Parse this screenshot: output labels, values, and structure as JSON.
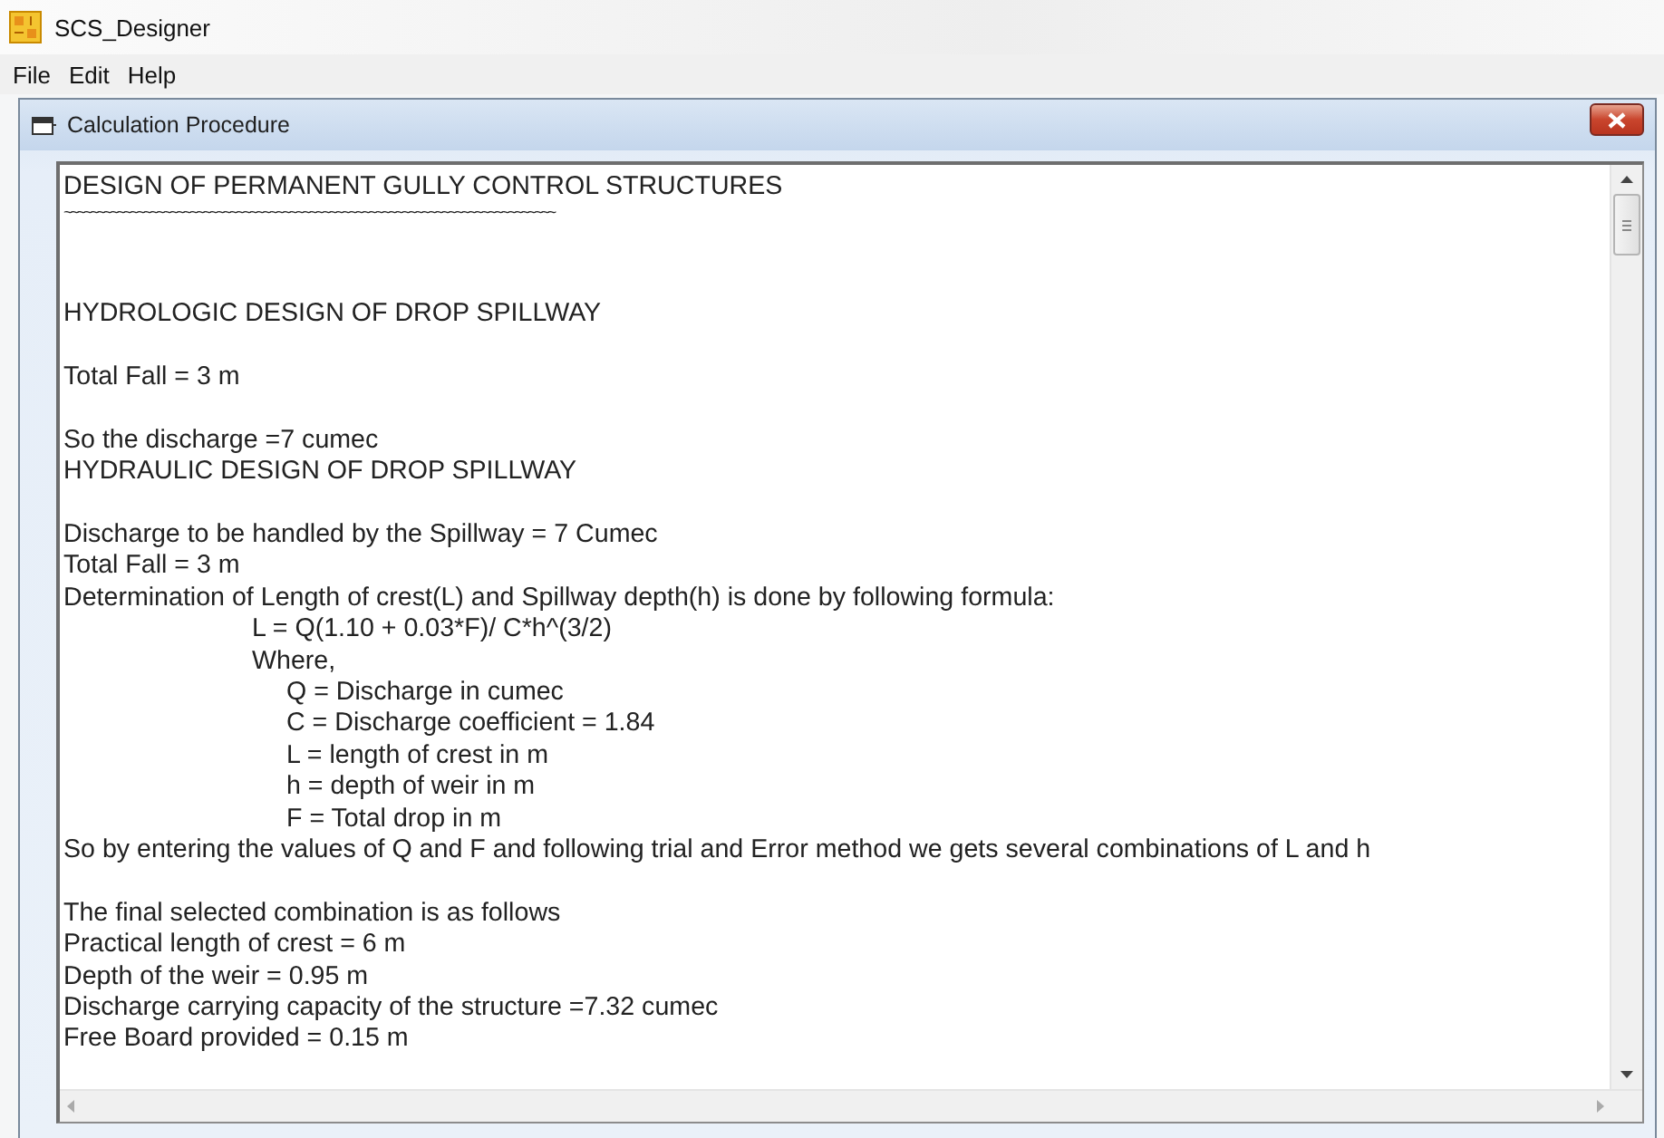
{
  "app": {
    "title": "SCS_Designer"
  },
  "menu": [
    {
      "label": "File"
    },
    {
      "label": "Edit"
    },
    {
      "label": "Help"
    }
  ],
  "child_window": {
    "title": "Calculation Procedure"
  },
  "document": {
    "lines": [
      {
        "kind": "text",
        "text": "DESIGN OF PERMANENT GULLY CONTROL STRUCTURES"
      },
      {
        "kind": "rule",
        "text": "~~~~~~~~~~~~~~~~~~~~~~~~~~~~~~~~~~~~~~~~~~~~~~~~~~~~~~~~~~~~~~~~~~~~~~~~~~"
      },
      {
        "kind": "gap"
      },
      {
        "kind": "gap"
      },
      {
        "kind": "text",
        "text": "HYDROLOGIC DESIGN OF DROP SPILLWAY"
      },
      {
        "kind": "gap"
      },
      {
        "kind": "text",
        "text": "Total Fall = 3 m"
      },
      {
        "kind": "gap"
      },
      {
        "kind": "text",
        "text": "So the discharge =7 cumec"
      },
      {
        "kind": "text",
        "text": "HYDRAULIC DESIGN OF DROP SPILLWAY"
      },
      {
        "kind": "gap"
      },
      {
        "kind": "text",
        "text": "Discharge to be handled by the Spillway = 7 Cumec"
      },
      {
        "kind": "text",
        "text": "Total Fall = 3 m"
      },
      {
        "kind": "text",
        "text": "Determination of Length of crest(L) and Spillway depth(h) is done by following formula:"
      },
      {
        "kind": "formula",
        "text": "L = Q(1.10 + 0.03*F)/ C*h^(3/2)"
      },
      {
        "kind": "formula",
        "text": "Where,"
      },
      {
        "kind": "term",
        "text": "Q = Discharge in cumec"
      },
      {
        "kind": "term",
        "text": "C = Discharge coefficient = 1.84"
      },
      {
        "kind": "term",
        "text": "L = length of crest in m"
      },
      {
        "kind": "term",
        "text": "h = depth of weir in m"
      },
      {
        "kind": "term",
        "text": "F = Total drop in m"
      },
      {
        "kind": "text",
        "text": "So by entering the values of Q and F and following trial and Error method we gets several combinations of L and h"
      },
      {
        "kind": "gap"
      },
      {
        "kind": "text",
        "text": "The final selected combination is as follows"
      },
      {
        "kind": "text",
        "text": "Practical length of crest = 6 m"
      },
      {
        "kind": "text",
        "text": "Depth of the weir = 0.95 m"
      },
      {
        "kind": "text",
        "text": "Discharge carrying capacity of the structure =7.32 cumec"
      },
      {
        "kind": "text",
        "text": "Free Board provided = 0.15 m"
      }
    ]
  }
}
